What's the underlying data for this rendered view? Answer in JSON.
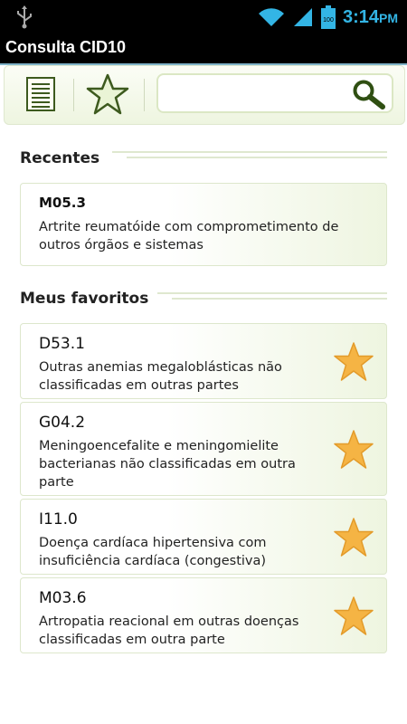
{
  "status_bar": {
    "time": "3:14",
    "ampm": "PM",
    "battery_level": "100"
  },
  "app": {
    "title": "Consulta CID10"
  },
  "search": {
    "value": "",
    "placeholder": ""
  },
  "recent": {
    "header": "Recentes",
    "items": [
      {
        "code": "M05.3",
        "description": "Artrite reumatóide com comprometimento de outros órgãos e sistemas"
      }
    ]
  },
  "favorites": {
    "header": "Meus favoritos",
    "items": [
      {
        "code": "D53.1",
        "description": "Outras anemias megaloblásticas não classificadas em outras partes"
      },
      {
        "code": "G04.2",
        "description": "Meningoencefalite e meningomielite bacterianas não classificadas em outra parte"
      },
      {
        "code": "I11.0",
        "description": "Doença cardíaca hipertensiva com insuficiência cardíaca (congestiva)"
      },
      {
        "code": "M03.6",
        "description": "Artropatia reacional em outras doenças classificadas em outra parte"
      }
    ]
  },
  "colors": {
    "accent": "#33b5e5",
    "star": "#f5b444",
    "card_tint": "#eef5e0"
  }
}
